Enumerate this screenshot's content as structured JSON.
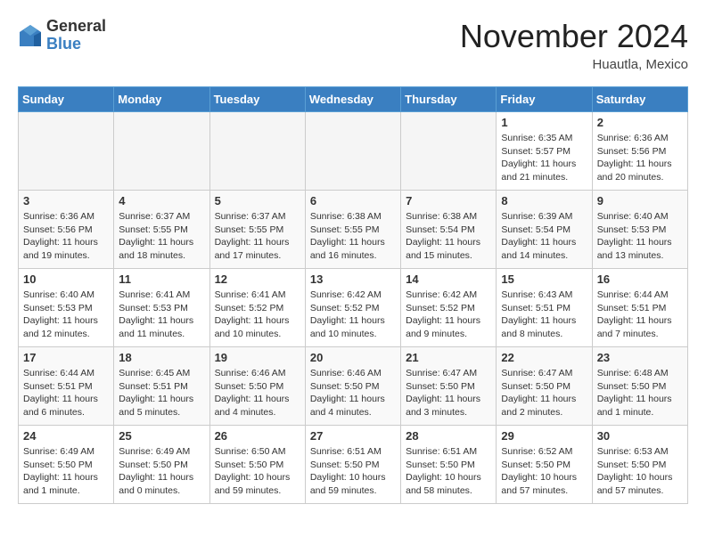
{
  "header": {
    "logo_general": "General",
    "logo_blue": "Blue",
    "month_title": "November 2024",
    "location": "Huautla, Mexico"
  },
  "weekdays": [
    "Sunday",
    "Monday",
    "Tuesday",
    "Wednesday",
    "Thursday",
    "Friday",
    "Saturday"
  ],
  "weeks": [
    [
      {
        "day": "",
        "info": ""
      },
      {
        "day": "",
        "info": ""
      },
      {
        "day": "",
        "info": ""
      },
      {
        "day": "",
        "info": ""
      },
      {
        "day": "",
        "info": ""
      },
      {
        "day": "1",
        "info": "Sunrise: 6:35 AM\nSunset: 5:57 PM\nDaylight: 11 hours and 21 minutes."
      },
      {
        "day": "2",
        "info": "Sunrise: 6:36 AM\nSunset: 5:56 PM\nDaylight: 11 hours and 20 minutes."
      }
    ],
    [
      {
        "day": "3",
        "info": "Sunrise: 6:36 AM\nSunset: 5:56 PM\nDaylight: 11 hours and 19 minutes."
      },
      {
        "day": "4",
        "info": "Sunrise: 6:37 AM\nSunset: 5:55 PM\nDaylight: 11 hours and 18 minutes."
      },
      {
        "day": "5",
        "info": "Sunrise: 6:37 AM\nSunset: 5:55 PM\nDaylight: 11 hours and 17 minutes."
      },
      {
        "day": "6",
        "info": "Sunrise: 6:38 AM\nSunset: 5:55 PM\nDaylight: 11 hours and 16 minutes."
      },
      {
        "day": "7",
        "info": "Sunrise: 6:38 AM\nSunset: 5:54 PM\nDaylight: 11 hours and 15 minutes."
      },
      {
        "day": "8",
        "info": "Sunrise: 6:39 AM\nSunset: 5:54 PM\nDaylight: 11 hours and 14 minutes."
      },
      {
        "day": "9",
        "info": "Sunrise: 6:40 AM\nSunset: 5:53 PM\nDaylight: 11 hours and 13 minutes."
      }
    ],
    [
      {
        "day": "10",
        "info": "Sunrise: 6:40 AM\nSunset: 5:53 PM\nDaylight: 11 hours and 12 minutes."
      },
      {
        "day": "11",
        "info": "Sunrise: 6:41 AM\nSunset: 5:53 PM\nDaylight: 11 hours and 11 minutes."
      },
      {
        "day": "12",
        "info": "Sunrise: 6:41 AM\nSunset: 5:52 PM\nDaylight: 11 hours and 10 minutes."
      },
      {
        "day": "13",
        "info": "Sunrise: 6:42 AM\nSunset: 5:52 PM\nDaylight: 11 hours and 10 minutes."
      },
      {
        "day": "14",
        "info": "Sunrise: 6:42 AM\nSunset: 5:52 PM\nDaylight: 11 hours and 9 minutes."
      },
      {
        "day": "15",
        "info": "Sunrise: 6:43 AM\nSunset: 5:51 PM\nDaylight: 11 hours and 8 minutes."
      },
      {
        "day": "16",
        "info": "Sunrise: 6:44 AM\nSunset: 5:51 PM\nDaylight: 11 hours and 7 minutes."
      }
    ],
    [
      {
        "day": "17",
        "info": "Sunrise: 6:44 AM\nSunset: 5:51 PM\nDaylight: 11 hours and 6 minutes."
      },
      {
        "day": "18",
        "info": "Sunrise: 6:45 AM\nSunset: 5:51 PM\nDaylight: 11 hours and 5 minutes."
      },
      {
        "day": "19",
        "info": "Sunrise: 6:46 AM\nSunset: 5:50 PM\nDaylight: 11 hours and 4 minutes."
      },
      {
        "day": "20",
        "info": "Sunrise: 6:46 AM\nSunset: 5:50 PM\nDaylight: 11 hours and 4 minutes."
      },
      {
        "day": "21",
        "info": "Sunrise: 6:47 AM\nSunset: 5:50 PM\nDaylight: 11 hours and 3 minutes."
      },
      {
        "day": "22",
        "info": "Sunrise: 6:47 AM\nSunset: 5:50 PM\nDaylight: 11 hours and 2 minutes."
      },
      {
        "day": "23",
        "info": "Sunrise: 6:48 AM\nSunset: 5:50 PM\nDaylight: 11 hours and 1 minute."
      }
    ],
    [
      {
        "day": "24",
        "info": "Sunrise: 6:49 AM\nSunset: 5:50 PM\nDaylight: 11 hours and 1 minute."
      },
      {
        "day": "25",
        "info": "Sunrise: 6:49 AM\nSunset: 5:50 PM\nDaylight: 11 hours and 0 minutes."
      },
      {
        "day": "26",
        "info": "Sunrise: 6:50 AM\nSunset: 5:50 PM\nDaylight: 10 hours and 59 minutes."
      },
      {
        "day": "27",
        "info": "Sunrise: 6:51 AM\nSunset: 5:50 PM\nDaylight: 10 hours and 59 minutes."
      },
      {
        "day": "28",
        "info": "Sunrise: 6:51 AM\nSunset: 5:50 PM\nDaylight: 10 hours and 58 minutes."
      },
      {
        "day": "29",
        "info": "Sunrise: 6:52 AM\nSunset: 5:50 PM\nDaylight: 10 hours and 57 minutes."
      },
      {
        "day": "30",
        "info": "Sunrise: 6:53 AM\nSunset: 5:50 PM\nDaylight: 10 hours and 57 minutes."
      }
    ]
  ]
}
